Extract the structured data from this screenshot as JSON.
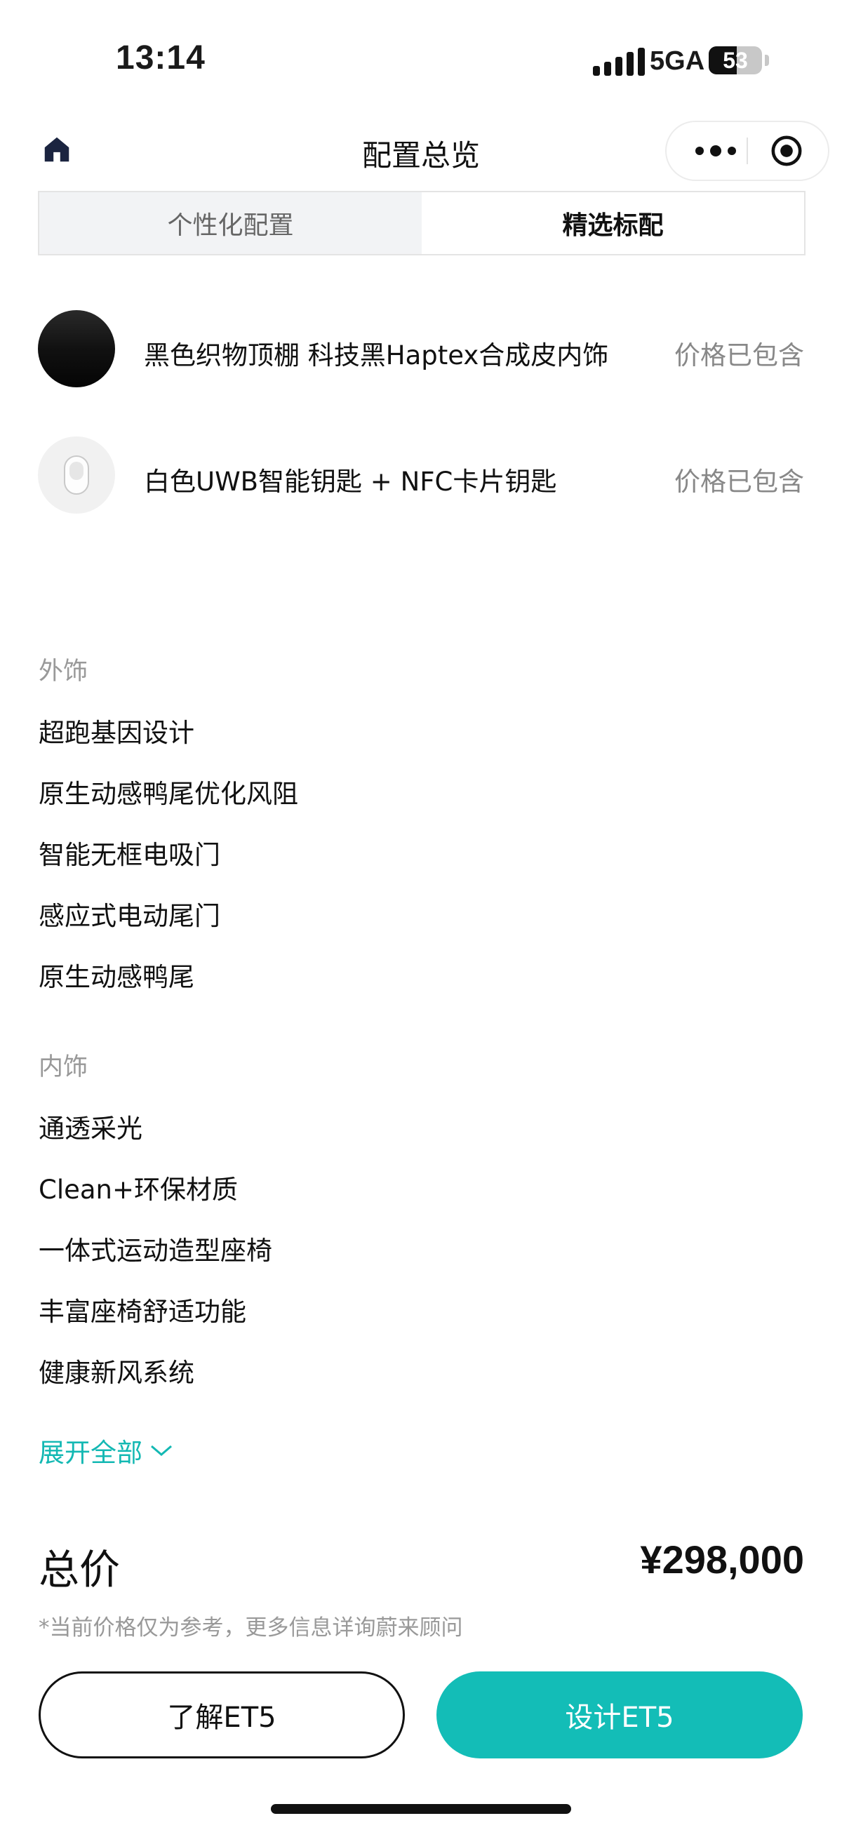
{
  "status_bar": {
    "time": "13:14",
    "network": "5GA",
    "battery": "53"
  },
  "nav": {
    "title": "配置总览"
  },
  "tabs": [
    {
      "label": "个性化配置",
      "active": false
    },
    {
      "label": "精选标配",
      "active": true
    }
  ],
  "config_items": [
    {
      "name": "黑色织物顶棚 科技黑Haptex合成皮内饰",
      "price_note": "价格已包含"
    },
    {
      "name": "白色UWB智能钥匙 + NFC卡片钥匙",
      "price_note": "价格已包含"
    }
  ],
  "exterior": {
    "title": "外饰",
    "items": [
      "超跑基因设计",
      "原生动感鸭尾优化风阻",
      "智能无框电吸门",
      "感应式电动尾门",
      "原生动感鸭尾"
    ]
  },
  "interior": {
    "title": "内饰",
    "items": [
      "通透采光",
      "Clean+环保材质",
      "一体式运动造型座椅",
      "丰富座椅舒适功能",
      "健康新风系统"
    ]
  },
  "expand_label": "展开全部",
  "total": {
    "label": "总价",
    "value": "¥298,000",
    "note": "*当前价格仅为参考，更多信息详询蔚来顾问"
  },
  "buttons": {
    "learn": "了解ET5",
    "design": "设计ET5"
  },
  "colors": {
    "accent": "#13bdb7",
    "text": "#111111",
    "muted": "#999999"
  }
}
